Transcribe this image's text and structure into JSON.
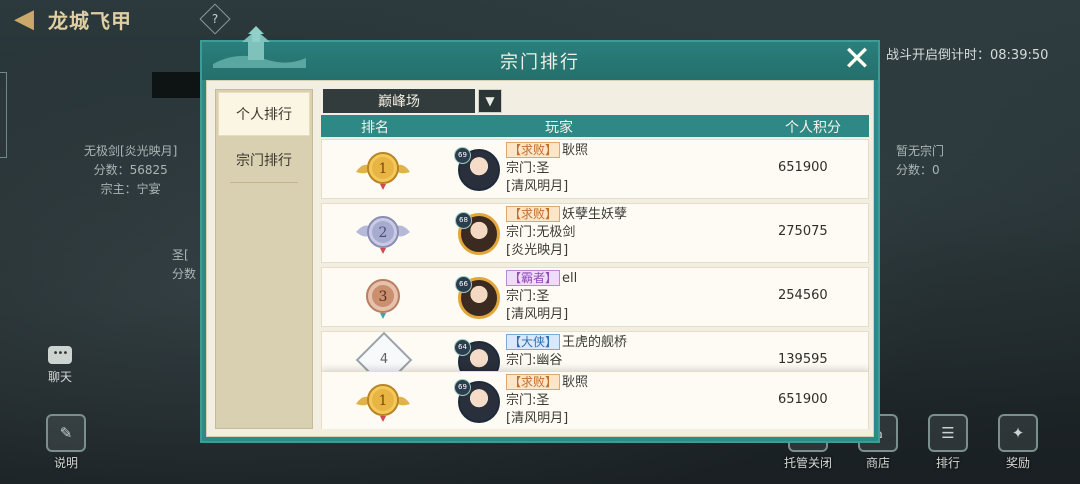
{
  "header": {
    "title": "龙城飞甲",
    "help": "?"
  },
  "countdown": "战斗开启倒计时：08:39:50",
  "left_info": {
    "line1": "无极剑[炎光映月]",
    "line2": "分数：56825",
    "line3": "宗主：宁宴"
  },
  "left_info2": {
    "line1": "圣[",
    "line2": "分数"
  },
  "right_info": {
    "line1": "暂无宗门",
    "line2": "分数：0"
  },
  "chat": {
    "label": "聊天"
  },
  "bottom_buttons": [
    {
      "label": "说明",
      "icon": "scroll-icon"
    },
    {
      "label": "托管关闭",
      "icon": "auto-icon"
    },
    {
      "label": "商店",
      "icon": "shop-icon"
    },
    {
      "label": "排行",
      "icon": "ranking-icon"
    },
    {
      "label": "奖励",
      "icon": "reward-icon"
    }
  ],
  "modal": {
    "title": "宗门排行",
    "close": "✕",
    "tabs": [
      {
        "label": "个人排行",
        "active": true
      },
      {
        "label": "宗门排行",
        "active": false
      }
    ],
    "dropdown": {
      "selected": "巅峰场"
    },
    "columns": {
      "rank": "排名",
      "player": "玩家",
      "score": "个人积分"
    },
    "rows": [
      {
        "rank": "1",
        "level": "69",
        "tag": "【求败】",
        "tag_color": "orange",
        "name": "耿照",
        "sect": "宗门:圣",
        "server": "[清风明月]",
        "score": "651900"
      },
      {
        "rank": "2",
        "level": "68",
        "tag": "【求败】",
        "tag_color": "orange",
        "name": "妖孽生妖孽",
        "sect": "宗门:无极剑",
        "server": "[炎光映月]",
        "score": "275075"
      },
      {
        "rank": "3",
        "level": "66",
        "tag": "【霸者】",
        "tag_color": "purple",
        "name": "ell",
        "sect": "宗门:圣",
        "server": "[清风明月]",
        "score": "254560"
      },
      {
        "rank": "4",
        "level": "64",
        "tag": "【大侠】",
        "tag_color": "blue",
        "name": "王虎的舰桥",
        "sect": "宗门:幽谷",
        "server": "",
        "score": "139595"
      }
    ],
    "my_row": {
      "rank": "1",
      "level": "69",
      "tag": "【求败】",
      "name": "耿照",
      "sect": "宗门:圣",
      "server": "[清风明月]",
      "score": "651900"
    }
  },
  "colors": {
    "modal_teal": "#2f8a86",
    "gold": "#d9a53a",
    "silver": "#a6a9c8",
    "bronze": "#c98f6e"
  }
}
